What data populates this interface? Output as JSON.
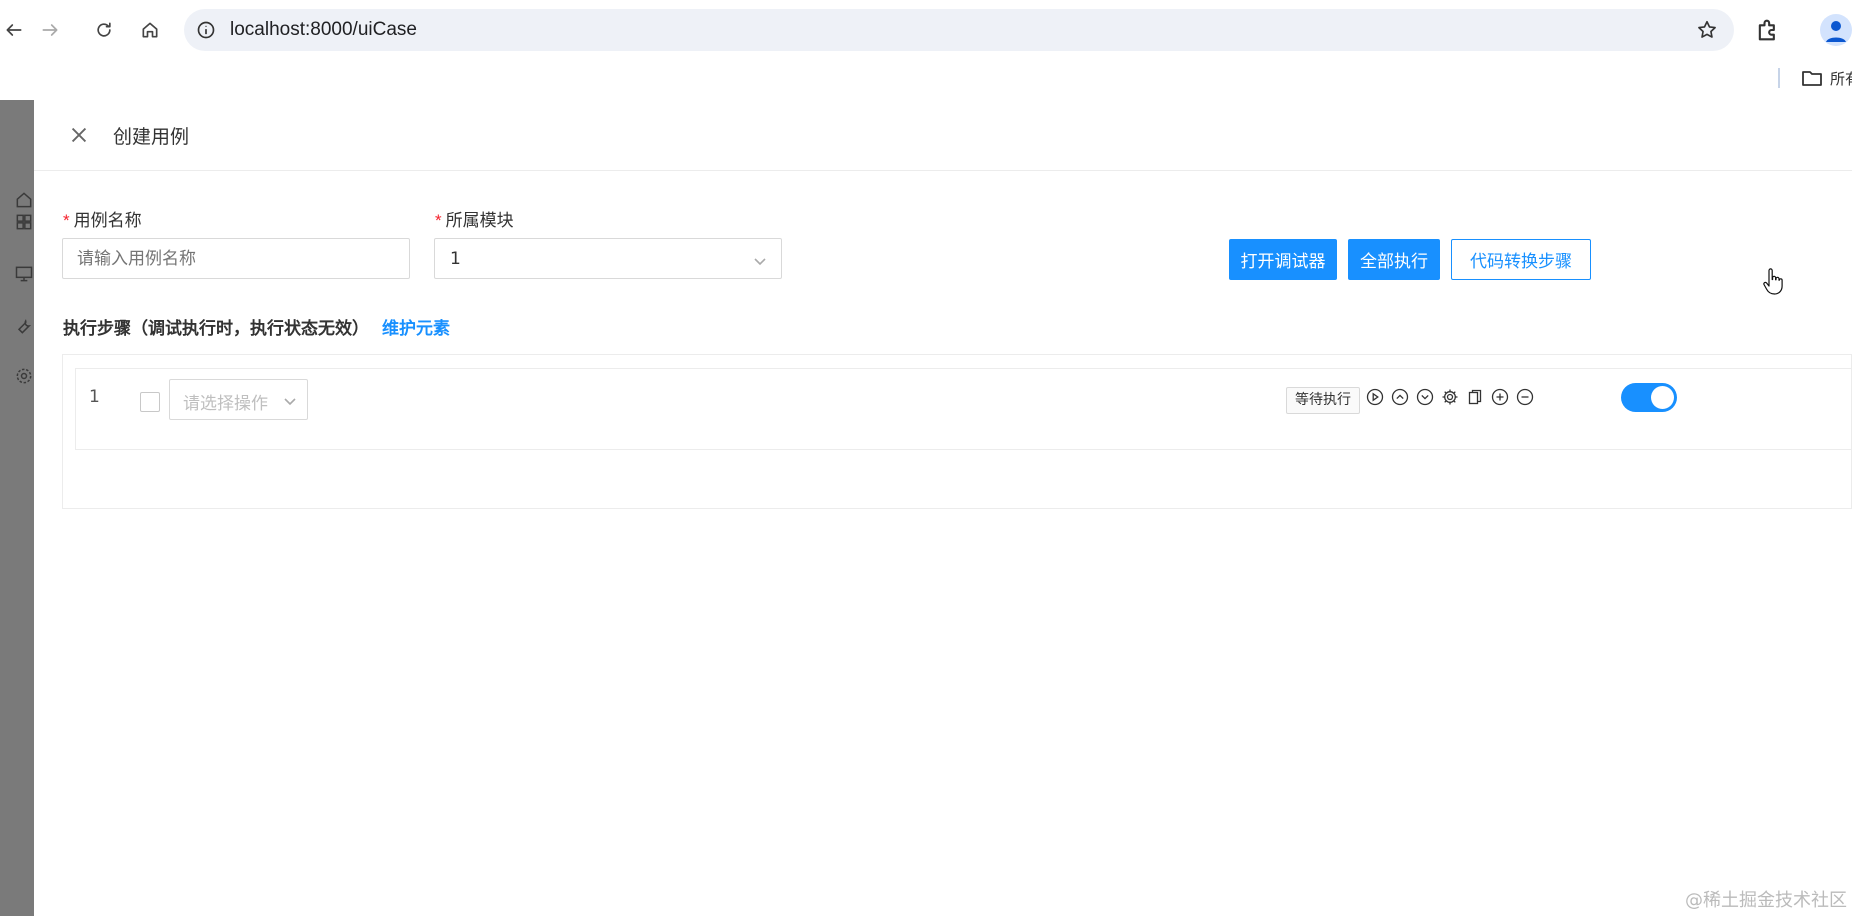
{
  "browser": {
    "url": "localhost:8000/uiCase",
    "bookmark_folder_label": "所有"
  },
  "drawer": {
    "title": "创建用例"
  },
  "form": {
    "case_name": {
      "label": "用例名称",
      "required_mark": "*",
      "placeholder": "请输入用例名称"
    },
    "module": {
      "label": "所属模块",
      "required_mark": "*",
      "value": "1"
    }
  },
  "buttons": {
    "open_debugger": "打开调试器",
    "run_all": "全部执行",
    "code_to_steps": "代码转换步骤"
  },
  "steps_section": {
    "title": "执行步骤（调试执行时，执行状态无效）",
    "link": "维护元素"
  },
  "steps": [
    {
      "number": "1",
      "operation_placeholder": "请选择操作",
      "status": "等待执行",
      "enabled": true
    }
  ],
  "icons": {
    "row_actions": [
      "play-icon",
      "move-up-icon",
      "move-down-icon",
      "settings-icon",
      "copy-icon",
      "add-icon",
      "remove-icon"
    ]
  },
  "watermark": "@稀土掘金技术社区",
  "colors": {
    "primary": "#1890ff",
    "required": "#f5222d"
  }
}
